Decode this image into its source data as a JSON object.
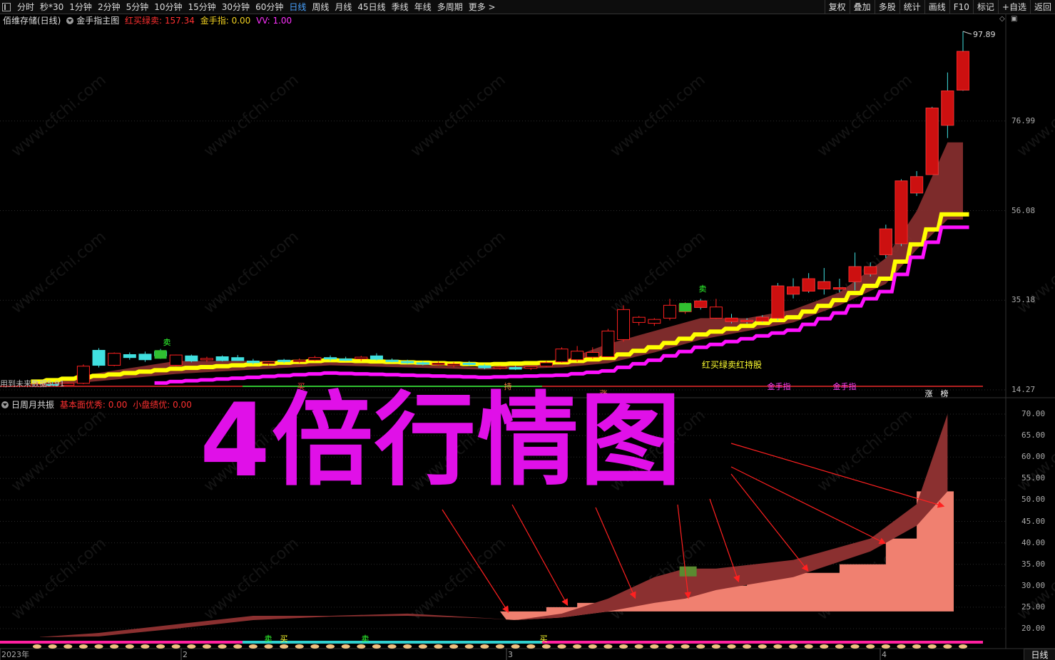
{
  "toolbar": {
    "periods": [
      "分时",
      "秒*30",
      "1分钟",
      "2分钟",
      "5分钟",
      "10分钟",
      "15分钟",
      "30分钟",
      "60分钟",
      "日线",
      "周线",
      "月线",
      "45日线",
      "季线",
      "年线",
      "多周期",
      "更多 >"
    ],
    "active_period": "日线",
    "right_buttons": [
      "复权",
      "叠加",
      "多股",
      "统计",
      "画线",
      "F10",
      "标记",
      "+自选",
      "返回"
    ]
  },
  "main_panel": {
    "stock": "佰维存储(日线)",
    "indicator_name": "金手指主图",
    "red_buy_label": "红买绿卖: 157.34",
    "gold_finger_label": "金手指: 0.00",
    "vv_label": "VV: 1.00",
    "legend_text": "红买绿卖红持股",
    "bottom_left_text": "用到未来数据5.91",
    "signal_labels": [
      "买",
      "卖",
      "卖",
      "持",
      "涨",
      "金手指",
      "金手指",
      "涨",
      "榜"
    ],
    "axis_ticks": [
      "76.99",
      "56.08",
      "35.18",
      "14.27"
    ],
    "high_label": "97.89"
  },
  "sub_panel": {
    "indicator_name": "日周月共振",
    "fundamental_label": "基本面优秀: 0.00",
    "small_cap_label": "小盘绩优: 0.00",
    "axis_ticks": [
      "70.00",
      "65.00",
      "60.00",
      "55.00",
      "50.00",
      "45.00",
      "40.00",
      "35.00",
      "30.00",
      "25.00",
      "20.00"
    ],
    "signal_labels": [
      "卖",
      "买",
      "卖",
      "买"
    ]
  },
  "x_axis": {
    "labels": [
      "2023年",
      "2",
      "3",
      "4"
    ]
  },
  "overlay_title": "4倍行情图",
  "watermark": "www.cfchi.com",
  "bottom_tag": "日线",
  "chart_data": {
    "type": "candlestick",
    "title": "佰维存储(日线)",
    "ylim": [
      14.27,
      97.89
    ],
    "y_ticks": [
      14.27,
      35.18,
      56.08,
      76.99
    ],
    "high": 97.89,
    "candles": [
      {
        "o": 15.2,
        "h": 16.0,
        "l": 14.9,
        "c": 15.6
      },
      {
        "o": 15.5,
        "h": 16.2,
        "l": 15.0,
        "c": 15.3
      },
      {
        "o": 15.3,
        "h": 16.0,
        "l": 15.0,
        "c": 15.8
      },
      {
        "o": 15.8,
        "h": 20.2,
        "l": 15.6,
        "c": 19.8
      },
      {
        "o": 23.5,
        "h": 24.0,
        "l": 19.5,
        "c": 20.0
      },
      {
        "o": 20.0,
        "h": 23.0,
        "l": 19.8,
        "c": 22.8
      },
      {
        "o": 22.5,
        "h": 23.0,
        "l": 21.3,
        "c": 21.8
      },
      {
        "o": 22.6,
        "h": 23.2,
        "l": 20.8,
        "c": 21.3
      },
      {
        "o": 23.2,
        "h": 23.8,
        "l": 21.5,
        "c": 22.2
      },
      {
        "o": 20.0,
        "h": 22.5,
        "l": 19.8,
        "c": 22.4
      },
      {
        "o": 22.2,
        "h": 22.5,
        "l": 20.7,
        "c": 21.0
      },
      {
        "o": 21.4,
        "h": 22.0,
        "l": 20.8,
        "c": 21.6
      },
      {
        "o": 22.0,
        "h": 22.3,
        "l": 20.9,
        "c": 21.1
      },
      {
        "o": 21.8,
        "h": 22.4,
        "l": 21.0,
        "c": 21.1
      },
      {
        "o": 21.0,
        "h": 21.5,
        "l": 20.2,
        "c": 20.6
      },
      {
        "o": 20.4,
        "h": 21.0,
        "l": 20.0,
        "c": 20.8
      },
      {
        "o": 21.2,
        "h": 21.5,
        "l": 20.5,
        "c": 20.9
      },
      {
        "o": 20.9,
        "h": 21.6,
        "l": 20.5,
        "c": 21.2
      },
      {
        "o": 21.2,
        "h": 22.2,
        "l": 21.0,
        "c": 21.8
      },
      {
        "o": 21.8,
        "h": 22.3,
        "l": 21.0,
        "c": 21.5
      },
      {
        "o": 21.5,
        "h": 22.0,
        "l": 21.0,
        "c": 21.3
      },
      {
        "o": 21.5,
        "h": 22.2,
        "l": 21.0,
        "c": 21.9
      },
      {
        "o": 22.2,
        "h": 22.8,
        "l": 21.1,
        "c": 21.4
      },
      {
        "o": 21.2,
        "h": 21.6,
        "l": 20.7,
        "c": 21.1
      },
      {
        "o": 20.9,
        "h": 21.3,
        "l": 20.3,
        "c": 20.8
      },
      {
        "o": 20.6,
        "h": 21.0,
        "l": 20.0,
        "c": 20.4
      },
      {
        "o": 20.4,
        "h": 20.9,
        "l": 19.9,
        "c": 20.5
      },
      {
        "o": 20.0,
        "h": 20.7,
        "l": 19.5,
        "c": 20.3
      },
      {
        "o": 20.5,
        "h": 21.0,
        "l": 19.9,
        "c": 20.2
      },
      {
        "o": 19.9,
        "h": 20.3,
        "l": 19.1,
        "c": 19.4
      },
      {
        "o": 19.4,
        "h": 19.9,
        "l": 19.0,
        "c": 19.6
      },
      {
        "o": 19.5,
        "h": 19.9,
        "l": 18.9,
        "c": 19.1
      },
      {
        "o": 19.3,
        "h": 19.8,
        "l": 18.9,
        "c": 19.7
      },
      {
        "o": 19.8,
        "h": 21.0,
        "l": 19.6,
        "c": 20.6
      },
      {
        "o": 20.8,
        "h": 24.2,
        "l": 20.6,
        "c": 23.8
      },
      {
        "o": 21.3,
        "h": 24.5,
        "l": 20.8,
        "c": 23.3
      },
      {
        "o": 21.9,
        "h": 24.2,
        "l": 21.5,
        "c": 23.0
      },
      {
        "o": 22.0,
        "h": 28.5,
        "l": 21.9,
        "c": 28.0
      },
      {
        "o": 26.0,
        "h": 34.0,
        "l": 25.5,
        "c": 33.0
      },
      {
        "o": 30.0,
        "h": 31.5,
        "l": 29.3,
        "c": 31.2
      },
      {
        "o": 29.8,
        "h": 31.0,
        "l": 29.2,
        "c": 30.7
      },
      {
        "o": 31.0,
        "h": 35.5,
        "l": 30.5,
        "c": 34.0
      },
      {
        "o": 32.5,
        "h": 34.7,
        "l": 32.0,
        "c": 34.2
      },
      {
        "o": 35.0,
        "h": 35.5,
        "l": 33.0,
        "c": 33.5
      },
      {
        "o": 31.0,
        "h": 35.5,
        "l": 30.8,
        "c": 33.6
      },
      {
        "o": 31.0,
        "h": 32.0,
        "l": 29.8,
        "c": 30.2
      },
      {
        "o": 30.5,
        "h": 31.0,
        "l": 29.7,
        "c": 30.2
      },
      {
        "o": 31.2,
        "h": 31.7,
        "l": 30.0,
        "c": 30.3
      },
      {
        "o": 38.5,
        "h": 39.2,
        "l": 30.5,
        "c": 31.0
      },
      {
        "o": 38.3,
        "h": 40.3,
        "l": 35.6,
        "c": 36.6
      },
      {
        "o": 40.2,
        "h": 41.5,
        "l": 36.9,
        "c": 37.3
      },
      {
        "o": 39.5,
        "h": 42.7,
        "l": 36.5,
        "c": 37.8
      },
      {
        "o": 38.1,
        "h": 40.2,
        "l": 37.0,
        "c": 37.8
      },
      {
        "o": 43.0,
        "h": 46.3,
        "l": 37.5,
        "c": 39.5
      },
      {
        "o": 43.0,
        "h": 44.0,
        "l": 40.7,
        "c": 41.3
      },
      {
        "o": 51.8,
        "h": 52.8,
        "l": 45.0,
        "c": 45.8
      },
      {
        "o": 63.0,
        "h": 63.4,
        "l": 47.8,
        "c": 48.4
      },
      {
        "o": 64.0,
        "h": 65.3,
        "l": 59.5,
        "c": 60.2
      },
      {
        "o": 80.0,
        "h": 80.3,
        "l": 64.5,
        "c": 64.5
      },
      {
        "o": 84.0,
        "h": 88.3,
        "l": 73.0,
        "c": 76.0
      },
      {
        "o": 93.2,
        "h": 97.9,
        "l": 84.0,
        "c": 84.2
      }
    ],
    "series": [
      {
        "name": "红买绿卖",
        "x": [
          1,
          10,
          20,
          30,
          35,
          38,
          41,
          44,
          47,
          50,
          53,
          56,
          58,
          60
        ],
        "values": [
          16,
          21,
          21,
          19.5,
          21,
          25,
          28,
          31,
          31,
          33,
          37,
          45,
          56,
          72
        ]
      },
      {
        "name": "金手指",
        "x": [
          1,
          10,
          20,
          30,
          35,
          38,
          41,
          44,
          47,
          50,
          53,
          56,
          58,
          60
        ],
        "values": [
          15,
          18,
          20,
          19,
          19.5,
          20.5,
          23,
          26,
          28,
          30,
          34,
          39,
          47,
          54
        ]
      }
    ],
    "sub_chart": {
      "title": "日周月共振",
      "ylim": [
        17,
        72
      ],
      "y_ticks": [
        70,
        65,
        60,
        55,
        50,
        45,
        40,
        35,
        30,
        25,
        20
      ],
      "resonance_upper": [
        [
          1,
          18
        ],
        [
          5,
          19
        ],
        [
          10,
          21
        ],
        [
          15,
          23
        ],
        [
          20,
          23
        ],
        [
          25,
          23.5
        ],
        [
          30,
          22.5
        ],
        [
          32,
          22
        ],
        [
          35,
          23.5
        ],
        [
          38,
          27
        ],
        [
          41,
          32
        ],
        [
          43,
          34
        ],
        [
          45,
          34
        ],
        [
          50,
          36
        ],
        [
          55,
          41
        ],
        [
          58,
          49
        ],
        [
          60,
          70
        ]
      ],
      "resonance_lower": [
        [
          1,
          18
        ],
        [
          5,
          18.2
        ],
        [
          10,
          20
        ],
        [
          15,
          22
        ],
        [
          20,
          22.8
        ],
        [
          25,
          23
        ],
        [
          30,
          22.4
        ],
        [
          32,
          22
        ],
        [
          35,
          22.6
        ],
        [
          38,
          24
        ],
        [
          41,
          26
        ],
        [
          43,
          27
        ],
        [
          45,
          29
        ],
        [
          50,
          32
        ],
        [
          55,
          38
        ],
        [
          58,
          44
        ],
        [
          60,
          52
        ]
      ],
      "step_band": [
        [
          31,
          24
        ],
        [
          34,
          25
        ],
        [
          36,
          26
        ],
        [
          38,
          27
        ],
        [
          42,
          30
        ],
        [
          47,
          33
        ],
        [
          53,
          35
        ],
        [
          56,
          41
        ],
        [
          58,
          52
        ],
        [
          60,
          52
        ]
      ]
    }
  }
}
